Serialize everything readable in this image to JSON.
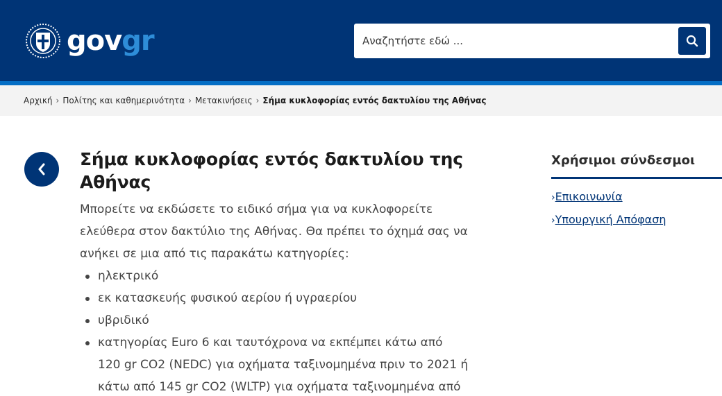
{
  "header": {
    "logo_text": "gov",
    "logo_text_accent": "gr",
    "colors": {
      "bar": "#003476",
      "stripe": "#046ec5",
      "accent": "#2e8dd8"
    }
  },
  "search": {
    "placeholder": "Αναζητήστε εδώ ...",
    "button_icon": "search-icon"
  },
  "breadcrumb": {
    "items": [
      "Αρχική",
      "Πολίτης και καθημερινότητα",
      "Μετακινήσεις"
    ],
    "current": "Σήμα κυκλοφορίας εντός δακτυλίου της Αθήνας"
  },
  "main": {
    "back_icon": "chevron-left-icon",
    "title": "Σήμα κυκλοφορίας εντός δακτυλίου της Αθήνας",
    "intro": "Μπορείτε να εκδώσετε το ειδικό σήμα για να κυκλοφορείτε ελεύθερα στον δακτύλιο της Αθήνας. Θα πρέπει το όχημά σας να ανήκει σε μια από τις παρακάτω κατηγορίες:",
    "categories": [
      "ηλεκτρικό",
      "εκ κατασκευής φυσικού αερίου ή υγραερίου",
      "υβριδικό",
      "κατηγορίας Euro 6 και ταυτόχρονα να εκπέμπει κάτω από 120 gr CO2 (NEDC) για οχήματα ταξινομημένα πριν το 2021 ή κάτω από 145 gr CO2 (WLTP) για οχήματα ταξινομημένα από"
    ]
  },
  "sidebar": {
    "title": "Χρήσιμοι σύνδεσμοι",
    "links": [
      "Επικοινωνία",
      "Υπουργική Απόφαση"
    ],
    "arrow": "›"
  }
}
